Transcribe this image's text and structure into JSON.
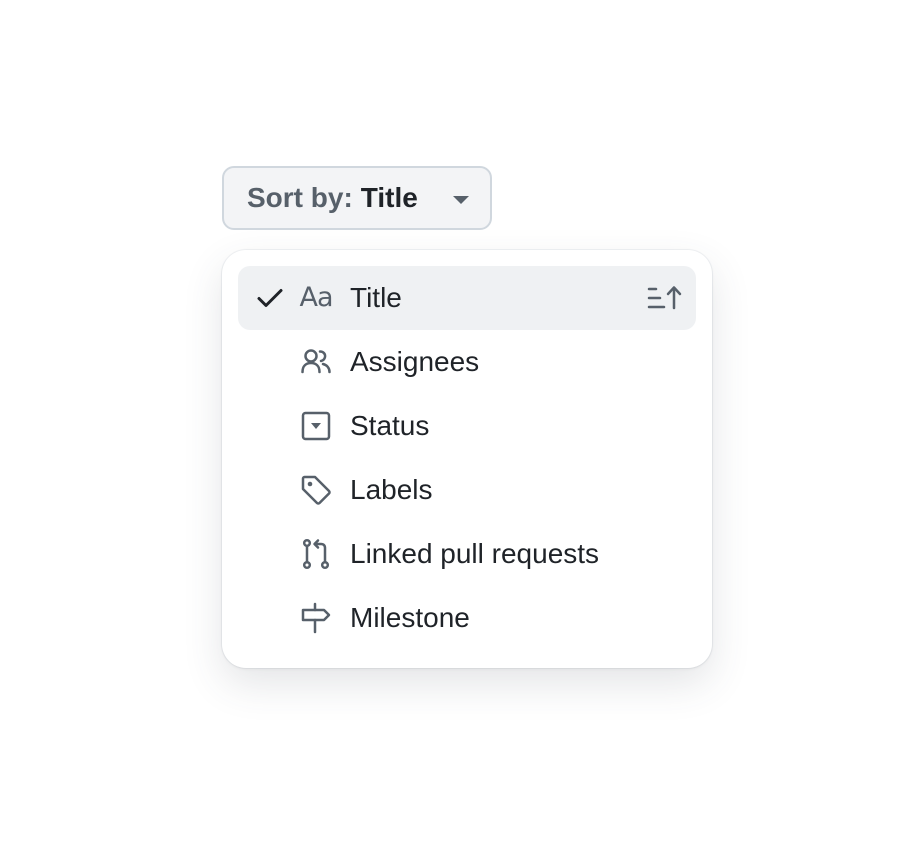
{
  "sort_button": {
    "prefix": "Sort by:",
    "value": "Title"
  },
  "menu": {
    "items": [
      {
        "label": "Title",
        "icon": "typography-icon",
        "selected": true,
        "glyph": "Aa"
      },
      {
        "label": "Assignees",
        "icon": "people-icon",
        "selected": false
      },
      {
        "label": "Status",
        "icon": "single-select-icon",
        "selected": false
      },
      {
        "label": "Labels",
        "icon": "tag-icon",
        "selected": false
      },
      {
        "label": "Linked pull requests",
        "icon": "git-pull-request-icon",
        "selected": false
      },
      {
        "label": "Milestone",
        "icon": "milestone-icon",
        "selected": false
      }
    ],
    "sort_direction": "ascending"
  },
  "colors": {
    "text": "#1f2328",
    "muted": "#57606a",
    "selected_bg": "#eff1f3",
    "button_bg": "#f3f4f6",
    "border": "#d0d7de"
  }
}
